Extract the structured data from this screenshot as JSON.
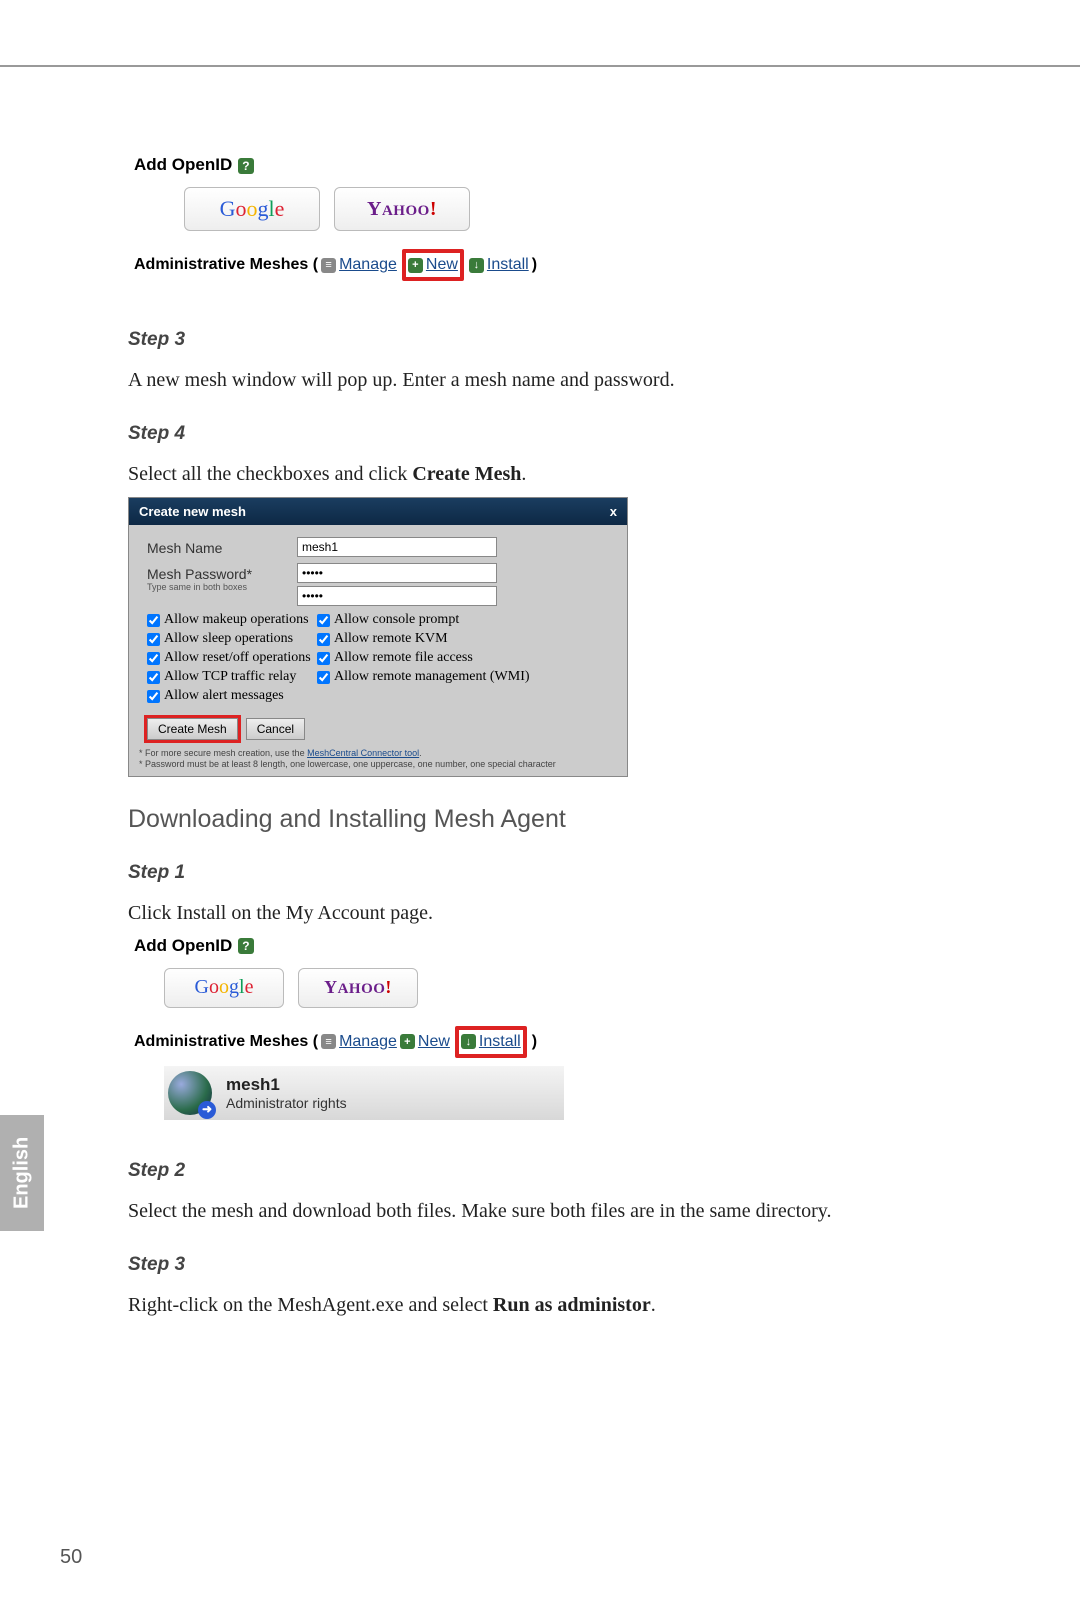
{
  "page_number": "50",
  "language_tab": "English",
  "shot1": {
    "add_openid": "Add OpenID",
    "help": "?",
    "google": "Google",
    "yahoo_prefix": "Y",
    "yahoo_mid": "AHOO",
    "yahoo_bang": "!",
    "admin_meshes_label": "Administrative Meshes (",
    "manage": "Manage",
    "new": "New",
    "install": "Install",
    "close_paren": ")"
  },
  "step3a": {
    "label": "Step 3",
    "text": "A new mesh window will pop up. Enter a mesh name and password."
  },
  "step4a": {
    "label": "Step 4",
    "text_prefix": "Select all the checkboxes and click ",
    "text_bold": "Create Mesh",
    "text_suffix": "."
  },
  "dialog": {
    "title": "Create new mesh",
    "close": "x",
    "name_label": "Mesh Name",
    "name_value": "mesh1",
    "pw_label": "Mesh Password*",
    "pw_sub": "Type same in both boxes",
    "pw_value": "•••••",
    "pw_value2": "•••••",
    "checks": {
      "c1": "Allow makeup operations",
      "c2": "Allow console prompt",
      "c3": "Allow sleep operations",
      "c4": "Allow remote KVM",
      "c5": "Allow reset/off operations",
      "c6": "Allow remote file access",
      "c7": "Allow TCP traffic relay",
      "c8": "Allow remote management (WMI)",
      "c9": "Allow alert messages"
    },
    "create_btn": "Create Mesh",
    "cancel_btn": "Cancel",
    "foot1_prefix": "* For more secure mesh creation, use the ",
    "foot1_link": "MeshCentral Connector tool",
    "foot1_suffix": ".",
    "foot2": "* Password must be at least 8 length, one lowercase, one uppercase, one number, one special character"
  },
  "section_heading": "Downloading and Installing Mesh Agent",
  "step1b": {
    "label": "Step 1",
    "text": "Click Install on the My Account page."
  },
  "shot3": {
    "add_openid": "Add OpenID",
    "help": "?",
    "google": "Google",
    "yahoo_prefix": "Y",
    "yahoo_mid": "AHOO",
    "yahoo_bang": "!",
    "admin_meshes_label": "Administrative Meshes (",
    "manage": "Manage",
    "new": "New",
    "install": "Install",
    "close_paren": ")",
    "mesh_name": "mesh1",
    "mesh_rights": "Administrator rights"
  },
  "step2b": {
    "label": "Step 2",
    "text": "Select the mesh and download both files. Make sure both files are in the same directory."
  },
  "step3b": {
    "label": "Step 3",
    "text_prefix": "Right-click on the MeshAgent.exe and select ",
    "text_bold": "Run as administor",
    "text_suffix": "."
  }
}
